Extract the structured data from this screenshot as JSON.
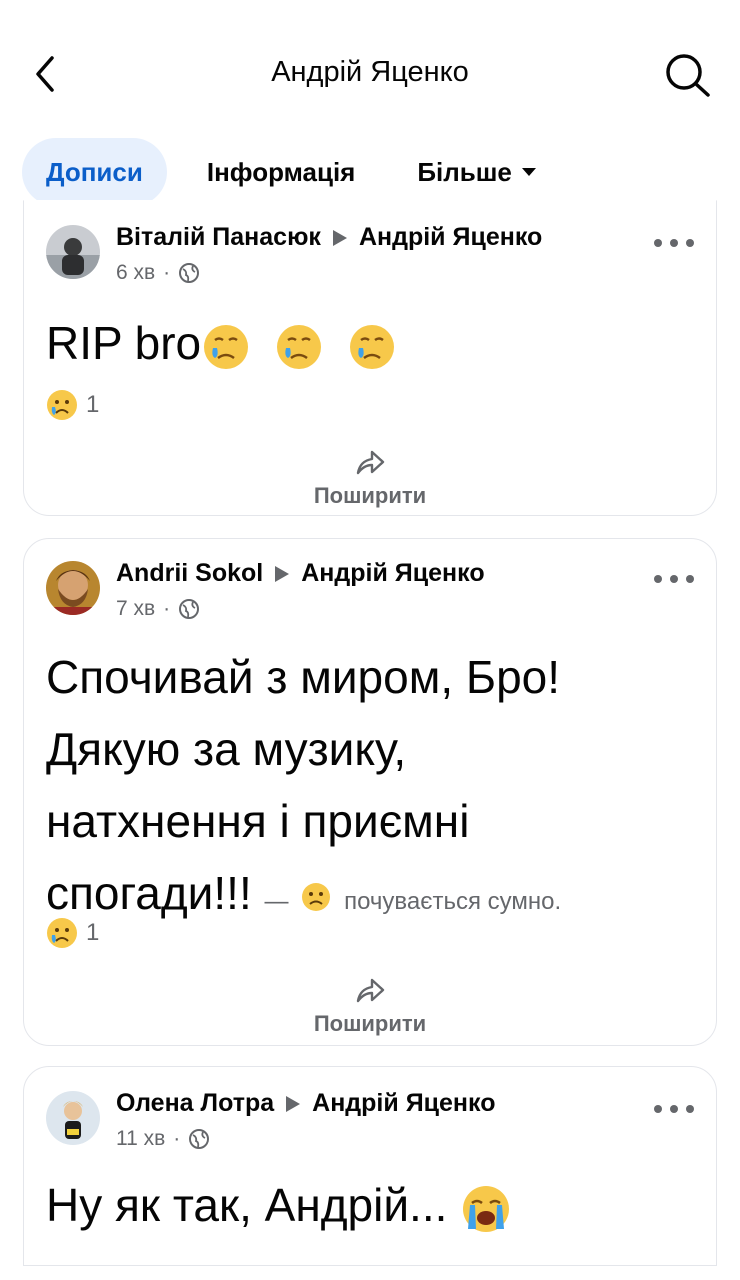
{
  "header": {
    "title": "Андрій Яценко",
    "back_icon": "chevron-left-icon",
    "search_icon": "search-icon"
  },
  "tabs": [
    {
      "label": "Дописи",
      "active": true
    },
    {
      "label": "Інформація",
      "active": false
    },
    {
      "label": "Більше",
      "active": false
    }
  ],
  "colors": {
    "accent": "#0b5ec9",
    "tab_active_bg": "#e7f0fd",
    "secondary_text": "#65676b",
    "border": "#e4e6eb"
  },
  "posts": [
    {
      "author": "Віталій Панасюк",
      "target": "Андрій Яценко",
      "time": "6 хв",
      "separator": "·",
      "privacy_icon": "globe-icon",
      "text": "RIP bro",
      "emojis": [
        "crying-face",
        "crying-face",
        "crying-face"
      ],
      "reaction_icon": "sad-face",
      "reaction_count": "1",
      "share_label": "Поширити"
    },
    {
      "author": "Andrii Sokol",
      "target": "Андрій Яценко",
      "time": "7 хв",
      "separator": "·",
      "privacy_icon": "globe-icon",
      "text_lines": [
        "Спочивай з миром, Бро!",
        "Дякую за музику,",
        "натхнення і приємні",
        "спогади!!!"
      ],
      "feeling_dash": "—",
      "feeling_text": "почувається сумно.",
      "reaction_icon": "sad-face",
      "reaction_count": "1",
      "share_label": "Поширити"
    },
    {
      "author": "Олена Лотра",
      "target": "Андрій Яценко",
      "time": "11 хв",
      "separator": "·",
      "privacy_icon": "globe-icon",
      "text": "Ну як так, Андрій...",
      "emojis": [
        "loudly-crying-face"
      ]
    }
  ]
}
